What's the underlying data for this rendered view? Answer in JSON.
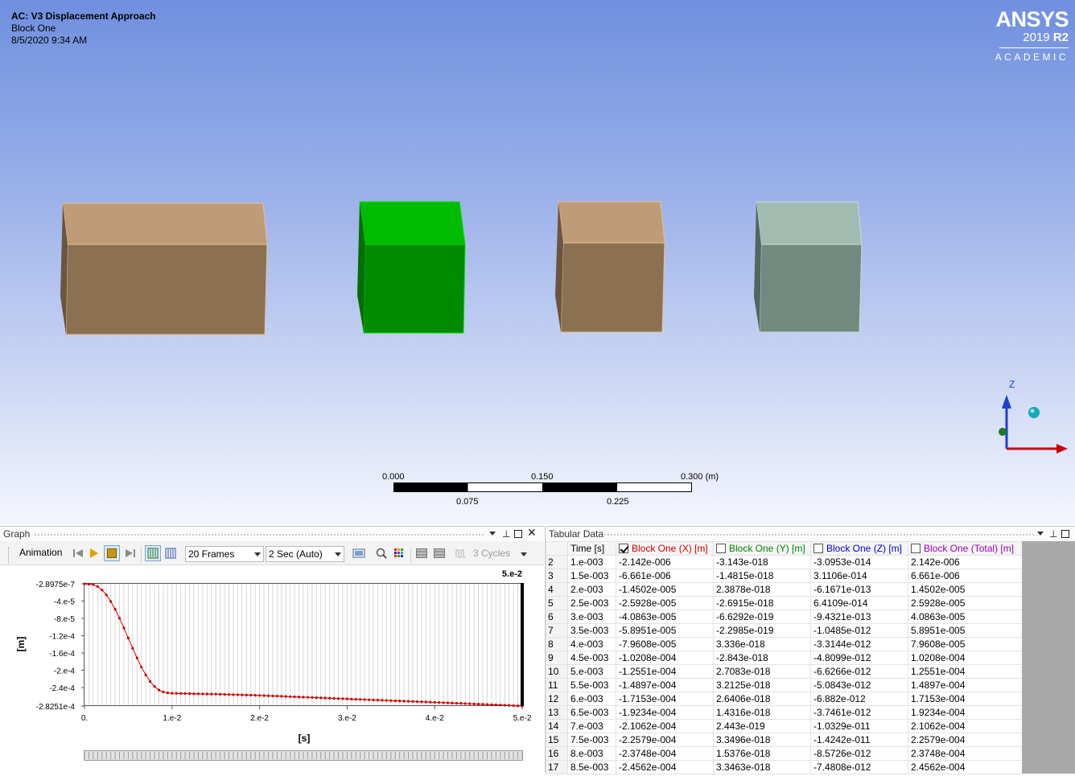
{
  "viewport": {
    "title": "AC: V3 Displacement Approach",
    "subtitle": "Block One",
    "date": "8/5/2020 9:34 AM",
    "logo": {
      "brand": "ANSYS",
      "year": "2019",
      "release": "R2",
      "edition": "ACADEMIC"
    },
    "triad": {
      "z_label": "Z"
    },
    "scale": {
      "labels_top": [
        "0.000",
        "0.150",
        "0.300 (m)"
      ],
      "labels_bottom": [
        "0.075",
        "0.225"
      ]
    },
    "colors": {
      "block_tan_front": "#8b7152",
      "block_tan_top": "#bf9c78",
      "block_green_front": "#008a00",
      "block_green_top": "#00bb00",
      "block_gray_front": "#718a80",
      "block_gray_top": "#a1bbb1"
    }
  },
  "graph_panel": {
    "title": "Graph",
    "animation_label": "Animation",
    "frames_value": "20 Frames",
    "duration_value": "2 Sec (Auto)",
    "cycles_value": "3 Cycles"
  },
  "chart_data": {
    "type": "line",
    "x_axis_label": "[s]",
    "y_axis_label": "[m]",
    "top_right_label": "5.e-2",
    "x_ticks": [
      "0.",
      "1.e-2",
      "2.e-2",
      "3.e-2",
      "4.e-2",
      "5.e-2"
    ],
    "y_ticks": [
      "-2.8975e-7",
      "-4.e-5",
      "-8.e-5",
      "-1.2e-4",
      "-1.6e-4",
      "-2.e-4",
      "-2.4e-4",
      "-2.8251e-4"
    ],
    "xlim": [
      0,
      0.05
    ],
    "ylim": [
      -0.00028251,
      -2.8975e-07
    ],
    "series": [
      {
        "color": "#cc0000",
        "x": [
          0,
          0.001,
          0.0015,
          0.002,
          0.0025,
          0.003,
          0.0035,
          0.004,
          0.0045,
          0.005,
          0.0055,
          0.006,
          0.0065,
          0.007,
          0.0075,
          0.008,
          0.0085,
          0.009,
          0.0095,
          0.01,
          0.012,
          0.015,
          0.02,
          0.025,
          0.03,
          0.035,
          0.04,
          0.045,
          0.05
        ],
        "y": [
          -2.8975e-07,
          -2.142e-06,
          -6.661e-06,
          -1.4502e-05,
          -2.5928e-05,
          -4.0863e-05,
          -5.8951e-05,
          -7.9608e-05,
          -0.00010208,
          -0.00012551,
          -0.00014897,
          -0.00017153,
          -0.00019234,
          -0.00021062,
          -0.00022579,
          -0.00023748,
          -0.00024562,
          -0.00025,
          -0.000252,
          -0.000253,
          -0.000254,
          -0.000255,
          -0.000258,
          -0.000262,
          -0.000266,
          -0.00027,
          -0.000274,
          -0.000278,
          -0.00028251
        ]
      }
    ]
  },
  "tabular": {
    "title": "Tabular Data",
    "headers": [
      "Time [s]",
      "Block One (X) [m]",
      "Block One (Y) [m]",
      "Block One (Z) [m]",
      "Block One (Total) [m]"
    ],
    "header_colors": [
      "#000000",
      "#cc0000",
      "#008800",
      "#0000cc",
      "#9900bb"
    ],
    "rows": [
      [
        "2",
        "1.e-003",
        "-2.142e-006",
        "-3.143e-018",
        "-3.0953e-014",
        "2.142e-006"
      ],
      [
        "3",
        "1.5e-003",
        "-6.661e-006",
        "-1.4815e-018",
        "3.1106e-014",
        "6.661e-006"
      ],
      [
        "4",
        "2.e-003",
        "-1.4502e-005",
        "2.3878e-018",
        "-6.1671e-013",
        "1.4502e-005"
      ],
      [
        "5",
        "2.5e-003",
        "-2.5928e-005",
        "-2.6915e-018",
        "6.4109e-014",
        "2.5928e-005"
      ],
      [
        "6",
        "3.e-003",
        "-4.0863e-005",
        "-6.6292e-019",
        "-9.4321e-013",
        "4.0863e-005"
      ],
      [
        "7",
        "3.5e-003",
        "-5.8951e-005",
        "-2.2985e-019",
        "-1.0485e-012",
        "5.8951e-005"
      ],
      [
        "8",
        "4.e-003",
        "-7.9608e-005",
        "3.336e-018",
        "-3.3144e-012",
        "7.9608e-005"
      ],
      [
        "9",
        "4.5e-003",
        "-1.0208e-004",
        "-2.843e-018",
        "-4.8099e-012",
        "1.0208e-004"
      ],
      [
        "10",
        "5.e-003",
        "-1.2551e-004",
        "2.7083e-018",
        "-6.6266e-012",
        "1.2551e-004"
      ],
      [
        "11",
        "5.5e-003",
        "-1.4897e-004",
        "3.2125e-018",
        "-5.0843e-012",
        "1.4897e-004"
      ],
      [
        "12",
        "6.e-003",
        "-1.7153e-004",
        "2.6406e-018",
        "-6.882e-012",
        "1.7153e-004"
      ],
      [
        "13",
        "6.5e-003",
        "-1.9234e-004",
        "1.4316e-018",
        "-3.7461e-012",
        "1.9234e-004"
      ],
      [
        "14",
        "7.e-003",
        "-2.1062e-004",
        "2.443e-019",
        "-1.0329e-011",
        "2.1062e-004"
      ],
      [
        "15",
        "7.5e-003",
        "-2.2579e-004",
        "3.3496e-018",
        "-1.4242e-011",
        "2.2579e-004"
      ],
      [
        "16",
        "8.e-003",
        "-2.3748e-004",
        "1.5376e-018",
        "-8.5726e-012",
        "2.3748e-004"
      ],
      [
        "17",
        "8.5e-003",
        "-2.4562e-004",
        "3.3463e-018",
        "-7.4808e-012",
        "2.4562e-004"
      ]
    ]
  }
}
